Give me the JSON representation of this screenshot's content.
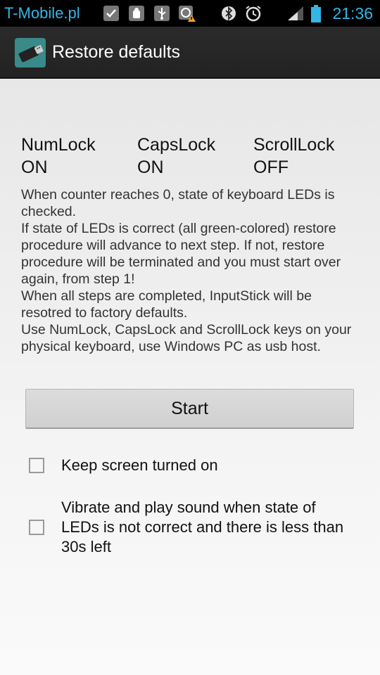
{
  "status_bar": {
    "carrier": "T-Mobile.pl",
    "time": "21:36",
    "icons": [
      "checkmark-icon",
      "android-debug-icon",
      "usb-icon",
      "warning-icon",
      "bluetooth-icon",
      "alarm-icon",
      "signal-icon",
      "battery-icon"
    ],
    "accent_color": "#33b5e5"
  },
  "action_bar": {
    "title": "Restore defaults",
    "icon": "usb-stick-icon"
  },
  "leds": [
    {
      "name": "NumLock",
      "state": "ON"
    },
    {
      "name": "CapsLock",
      "state": "ON"
    },
    {
      "name": "ScrollLock",
      "state": "OFF"
    }
  ],
  "description": [
    "When counter reaches 0, state of keyboard LEDs is checked.",
    "If state of LEDs is correct (all green-colored) restore procedure will advance to next step. If not, restore procedure will be terminated and you must start over again, from step 1!",
    "When all steps are completed, InputStick will be resotred to factory defaults.",
    "Use NumLock, CapsLock and ScrollLock keys on your physical keyboard, use Windows PC as usb host."
  ],
  "start_button": "Start",
  "options": [
    {
      "label": "Keep screen turned on",
      "checked": false
    },
    {
      "label": "Vibrate and play sound when state of LEDs is not correct and there is less than 30s left",
      "checked": false
    }
  ]
}
